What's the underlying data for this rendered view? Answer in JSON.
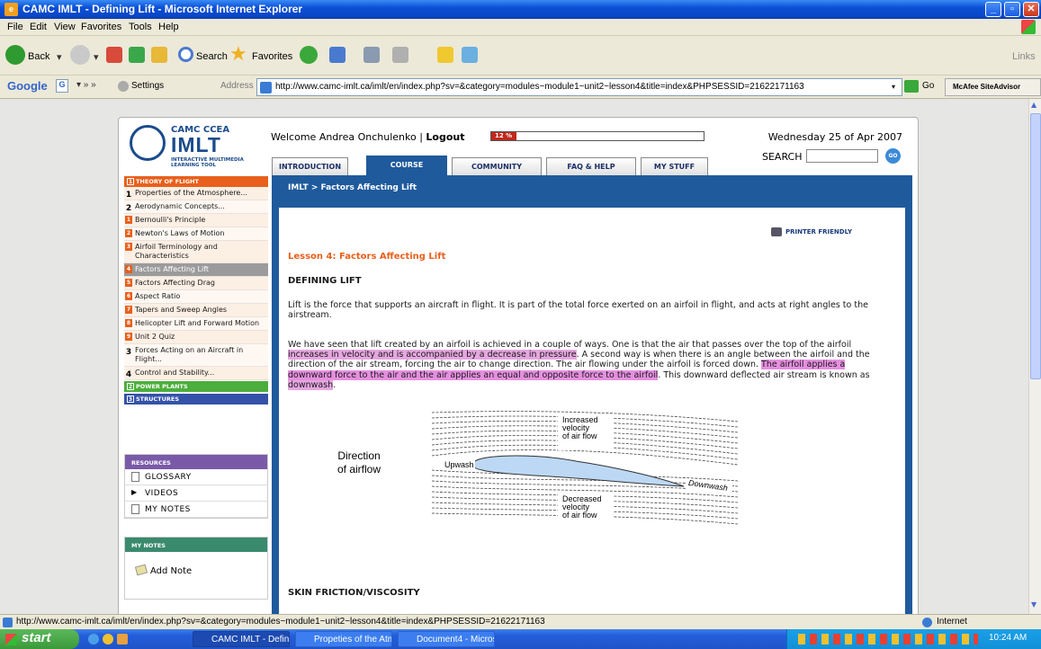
{
  "window": {
    "title": "CAMC IMLT - Defining Lift - Microsoft Internet Explorer"
  },
  "menu": [
    "File",
    "Edit",
    "View",
    "Favorites",
    "Tools",
    "Help"
  ],
  "toolbar": {
    "back": "Back",
    "search": "Search",
    "favorites": "Favorites",
    "links": "Links"
  },
  "google_bar": {
    "label": "Google",
    "settings": "Settings"
  },
  "address": {
    "label": "Address",
    "url": "http://www.camc-imlt.ca/imlt/en/index.php?sv=&category=modules~module1~unit2~lesson4&title=index&PHPSESSID=21622171163",
    "go": "Go"
  },
  "mcafee": "McAfee SiteAdvisor",
  "site": {
    "logo_top": "CAMC  CCEA",
    "logo_main": "IMLT",
    "logo_sub1": "INTERACTIVE MULTIMEDIA",
    "logo_sub2": "LEARNING TOOL",
    "welcome_prefix": "Welcome Andrea Onchulenko | ",
    "logout": "Logout",
    "progress_label": "12 %",
    "progress_value": 0.12,
    "date": "Wednesday 25 of Apr 2007",
    "search_label": "SEARCH",
    "search_go": "GO"
  },
  "tabs": [
    {
      "label": "INTRODUCTION",
      "active": false
    },
    {
      "label": "COURSE",
      "active": true
    },
    {
      "label": "COMMUNITY",
      "active": false
    },
    {
      "label": "FAQ & HELP",
      "active": false
    },
    {
      "label": "MY STUFF",
      "active": false
    }
  ],
  "sidebar": {
    "section1": {
      "num": "1",
      "label": "THEORY OF FLIGHT"
    },
    "items": [
      {
        "num": "1",
        "label": "Properties of the Atmosphere...",
        "style": "big"
      },
      {
        "num": "2",
        "label": "Aerodynamic Concepts...",
        "style": "big"
      },
      {
        "num": "1",
        "label": "Bernoulli's Principle",
        "style": "o"
      },
      {
        "num": "2",
        "label": "Newton's Laws of Motion",
        "style": "o"
      },
      {
        "num": "3",
        "label": "Airfoil Terminology and Characteristics",
        "style": "o"
      },
      {
        "num": "4",
        "label": "Factors Affecting Lift",
        "style": "o",
        "selected": true
      },
      {
        "num": "5",
        "label": "Factors Affecting Drag",
        "style": "o"
      },
      {
        "num": "6",
        "label": "Aspect Ratio",
        "style": "o"
      },
      {
        "num": "7",
        "label": "Tapers and Sweep Angles",
        "style": "o"
      },
      {
        "num": "8",
        "label": "Helicopter Lift and Forward Motion",
        "style": "o"
      },
      {
        "num": "9",
        "label": "Unit 2 Quiz",
        "style": "o"
      },
      {
        "num": "3",
        "label": "Forces Acting on an Aircraft in Flight...",
        "style": "big"
      },
      {
        "num": "4",
        "label": "Control and Stability...",
        "style": "big"
      }
    ],
    "section2": {
      "num": "2",
      "label": "POWER PLANTS"
    },
    "section3": {
      "num": "3",
      "label": "STRUCTURES"
    }
  },
  "resources": {
    "title": "RESOURCES",
    "items": [
      "GLOSSARY",
      "VIDEOS",
      "MY NOTES"
    ]
  },
  "mynotes": {
    "title": "MY NOTES",
    "add": "Add Note"
  },
  "content": {
    "breadcrumb": "IMLT > Factors Affecting Lift",
    "printer": "PRINTER FRIENDLY",
    "lesson_title": "Lesson 4: Factors Affecting Lift",
    "heading": "DEFINING LIFT",
    "para1": "Lift is the force that supports an aircraft in flight. It is part of the total force exerted on an airfoil in flight, and acts at right angles to the airstream.",
    "p2a": "We have seen that lift created by an airfoil is achieved in a couple of ways. One is that the air that passes over the top of the airfoil ",
    "p2b": "increases in velocity and is accompanied by a decrease in pressure",
    "p2c": ". A second way is when there is an angle between the airfoil and the direction of the air stream, forcing the air to change direction. The air flowing under the airfoil is forced down. ",
    "p2d": "The airfoil applies a downward force to the air and the air applies an equal and opposite force to the airfoil",
    "p2e": ". This downward deflected air stream is known as ",
    "p2f": "downwash",
    "p2g": ".",
    "diagram": {
      "direction1": "Direction",
      "direction2": "of airflow",
      "upwash": "Upwash",
      "downwash": "Downwash",
      "inc1": "Increased",
      "inc2": "velocity",
      "inc3": "of air flow",
      "dec1": "Decreased",
      "dec2": "velocity",
      "dec3": "of air flow"
    },
    "heading2": "SKIN FRICTION/VISCOSITY"
  },
  "statusbar": {
    "url": "http://www.camc-imlt.ca/imlt/en/index.php?sv=&category=modules~module1~unit2~lesson4&title=index&PHPSESSID=21622171163",
    "zone": "Internet"
  },
  "taskbar": {
    "start": "start",
    "items": [
      "CAMC IMLT - Defining...",
      "Propeties of the Atm...",
      "Document4 - Microsof..."
    ],
    "clock": "10:24 AM"
  },
  "colors": {
    "accent": "#1f5a9c",
    "theory": "#e8601c",
    "power": "#4cae3c",
    "structures": "#3452a8",
    "resources": "#7a5aa8",
    "mynotes": "#3a8a6e",
    "highlight": "#e6a6e0"
  }
}
